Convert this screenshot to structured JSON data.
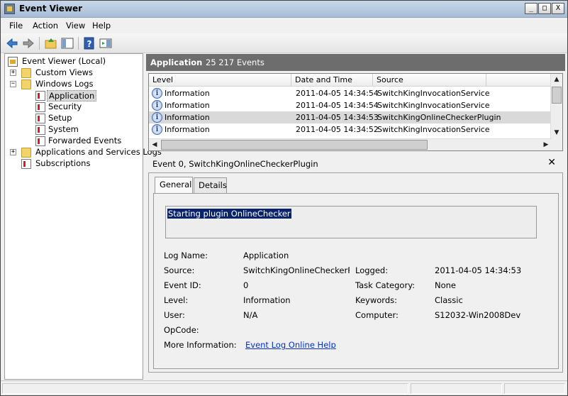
{
  "window": {
    "title": "Event Viewer",
    "buttons": [
      "_",
      "□",
      "X"
    ]
  },
  "menu": [
    "File",
    "Action",
    "View",
    "Help"
  ],
  "tree": {
    "root": "Event Viewer (Local)",
    "items": [
      {
        "label": "Custom Views"
      },
      {
        "label": "Windows Logs"
      },
      {
        "label": "Application"
      },
      {
        "label": "Security"
      },
      {
        "label": "Setup"
      },
      {
        "label": "System"
      },
      {
        "label": "Forwarded Events"
      },
      {
        "label": "Applications and Services Logs"
      },
      {
        "label": "Subscriptions"
      }
    ]
  },
  "header": {
    "title": "Application",
    "count": "25 217 Events"
  },
  "events": {
    "columns": [
      "Level",
      "Date and Time",
      "Source"
    ],
    "rows": [
      {
        "level": "Information",
        "datetime": "2011-04-05 14:34:54",
        "source": "SwitchKingInvocationService"
      },
      {
        "level": "Information",
        "datetime": "2011-04-05 14:34:54",
        "source": "SwitchKingInvocationService"
      },
      {
        "level": "Information",
        "datetime": "2011-04-05 14:34:53",
        "source": "SwitchKingOnlineCheckerPlugin"
      },
      {
        "level": "Information",
        "datetime": "2011-04-05 14:34:52",
        "source": "SwitchKingInvocationService"
      }
    ]
  },
  "detail": {
    "title": "Event 0, SwitchKingOnlineCheckerPlugin",
    "tabs": [
      "General",
      "Details"
    ],
    "message": "Starting plugin OnlineChecker",
    "labels": {
      "log_name": "Log Name:",
      "source": "Source:",
      "event_id": "Event ID:",
      "level": "Level:",
      "user": "User:",
      "opcode": "OpCode:",
      "more_info": "More Information:",
      "logged": "Logged:",
      "task_category": "Task Category:",
      "keywords": "Keywords:",
      "computer": "Computer:"
    },
    "values": {
      "log_name": "Application",
      "source": "SwitchKingOnlineCheckerPlu",
      "event_id": "0",
      "level": "Information",
      "user": "N/A",
      "opcode": "",
      "more_info": "Event Log Online Help",
      "logged": "2011-04-05 14:34:53",
      "task_category": "None",
      "keywords": "Classic",
      "computer": "S12032-Win2008Dev"
    }
  }
}
